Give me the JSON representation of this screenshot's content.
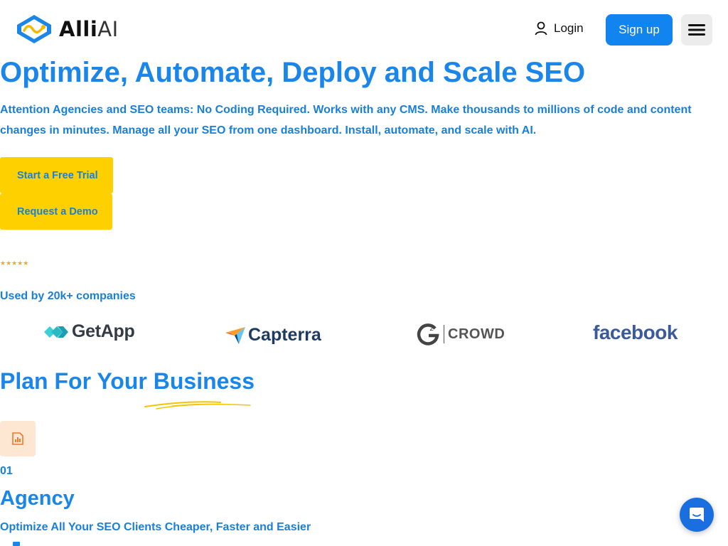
{
  "header": {
    "logo_bold": "Alli",
    "logo_thin": "AI",
    "login_label": "Login",
    "signup_label": "Sign up",
    "menu_icon": "hamburger-icon"
  },
  "hero": {
    "title": "Optimize, Automate, Deploy and Scale SEO",
    "subtitle": "Attention Agencies and SEO teams: No Coding Required. Works with any CMS. Make thousands to millions of code and content changes in minutes. Manage all your SEO from one dashboard. Install, automate, and scale with AI.",
    "cta_trial": "Start a Free Trial",
    "cta_demo": "Request a Demo",
    "stars": "★★★★★",
    "used_by": "Used by 20k+ companies"
  },
  "brands": {
    "getapp": "GetApp",
    "capterra": "Capterra",
    "g2_mark": "2",
    "g2": "CROWD",
    "facebook": "facebook"
  },
  "plans": {
    "title": "Plan For Your Business",
    "items": [
      {
        "number": "01",
        "name": "Agency",
        "description": "Optimize All Your SEO Clients Cheaper, Faster and Easier",
        "icon": "report-chart-icon"
      }
    ]
  },
  "colors": {
    "brand_blue": "#1a86ea",
    "signup_bg": "#1184f0",
    "cta_yellow": "#ffd000",
    "star": "#f5a623",
    "chat_bg": "#1a6fe0"
  },
  "chat_icon": "chat-bubble-icon"
}
